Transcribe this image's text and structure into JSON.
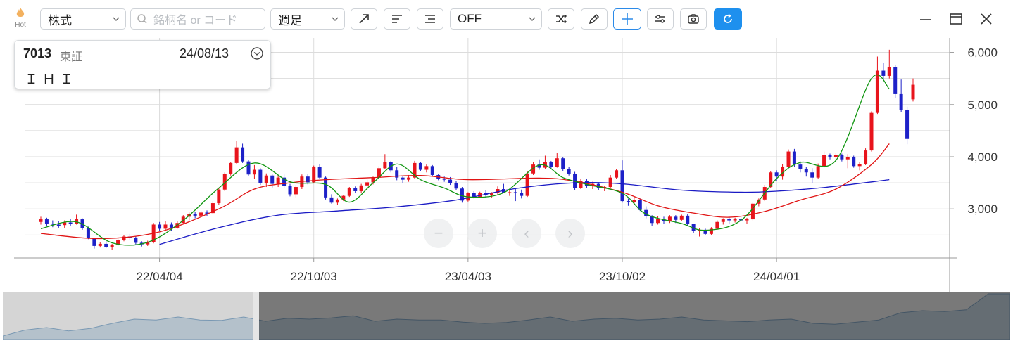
{
  "toolbar": {
    "hot_label": "Hot",
    "market_type": "株式",
    "search_placeholder": "銘柄名 or コード",
    "period": "週足",
    "indicator": "OFF"
  },
  "info": {
    "code": "7013",
    "market": "東証",
    "date": "24/08/13",
    "name": "ＩＨＩ"
  },
  "nav_buttons": {
    "zoom_out": "−",
    "zoom_in": "+",
    "prev": "‹",
    "next": "›"
  },
  "colors": {
    "up": "#e8141c",
    "down": "#1d21c8",
    "ma_short": "#119611",
    "ma_mid": "#e01414",
    "ma_long": "#1a1ac4",
    "accent": "#1e90ee"
  },
  "chart_data": {
    "type": "candlestick",
    "ylim": [
      2100,
      6250
    ],
    "y_ticks": [
      3000,
      4000,
      5000,
      6000
    ],
    "y_tick_labels": [
      "3,000",
      "4,000",
      "5,000",
      "6,000"
    ],
    "x_tick_labels": [
      "22/04/04",
      "22/10/03",
      "23/04/03",
      "23/10/02",
      "24/04/01"
    ],
    "x_tick_index": [
      20,
      46,
      72,
      98,
      124
    ],
    "candles": [
      [
        2750,
        2850,
        2700,
        2800
      ],
      [
        2800,
        2830,
        2680,
        2720
      ],
      [
        2720,
        2780,
        2650,
        2700
      ],
      [
        2700,
        2760,
        2640,
        2690
      ],
      [
        2690,
        2780,
        2640,
        2740
      ],
      [
        2740,
        2800,
        2680,
        2720
      ],
      [
        2720,
        2890,
        2700,
        2800
      ],
      [
        2800,
        2820,
        2600,
        2630
      ],
      [
        2630,
        2660,
        2420,
        2440
      ],
      [
        2440,
        2450,
        2240,
        2290
      ],
      [
        2290,
        2360,
        2260,
        2330
      ],
      [
        2330,
        2380,
        2250,
        2270
      ],
      [
        2270,
        2330,
        2210,
        2310
      ],
      [
        2310,
        2440,
        2290,
        2410
      ],
      [
        2410,
        2500,
        2380,
        2470
      ],
      [
        2470,
        2520,
        2400,
        2440
      ],
      [
        2440,
        2470,
        2320,
        2350
      ],
      [
        2350,
        2380,
        2280,
        2320
      ],
      [
        2320,
        2390,
        2290,
        2360
      ],
      [
        2360,
        2730,
        2340,
        2700
      ],
      [
        2700,
        2750,
        2580,
        2620
      ],
      [
        2620,
        2770,
        2590,
        2700
      ],
      [
        2700,
        2740,
        2580,
        2640
      ],
      [
        2640,
        2760,
        2620,
        2730
      ],
      [
        2730,
        2880,
        2710,
        2850
      ],
      [
        2850,
        2930,
        2780,
        2900
      ],
      [
        2900,
        2940,
        2820,
        2870
      ],
      [
        2870,
        2960,
        2840,
        2930
      ],
      [
        2930,
        2970,
        2860,
        2920
      ],
      [
        2920,
        3150,
        2900,
        3110
      ],
      [
        3110,
        3400,
        3080,
        3370
      ],
      [
        3370,
        3700,
        3340,
        3670
      ],
      [
        3670,
        3900,
        3640,
        3880
      ],
      [
        3880,
        4300,
        3860,
        4180
      ],
      [
        4180,
        4250,
        3880,
        3910
      ],
      [
        3910,
        3930,
        3640,
        3660
      ],
      [
        3660,
        3840,
        3580,
        3750
      ],
      [
        3750,
        3780,
        3460,
        3490
      ],
      [
        3490,
        3680,
        3420,
        3640
      ],
      [
        3640,
        3660,
        3410,
        3480
      ],
      [
        3480,
        3650,
        3420,
        3600
      ],
      [
        3600,
        3660,
        3400,
        3440
      ],
      [
        3440,
        3480,
        3240,
        3280
      ],
      [
        3280,
        3460,
        3220,
        3420
      ],
      [
        3420,
        3660,
        3380,
        3620
      ],
      [
        3620,
        3670,
        3470,
        3510
      ],
      [
        3510,
        3830,
        3490,
        3800
      ],
      [
        3800,
        3860,
        3570,
        3600
      ],
      [
        3600,
        3620,
        3180,
        3220
      ],
      [
        3220,
        3280,
        3100,
        3120
      ],
      [
        3120,
        3200,
        3080,
        3180
      ],
      [
        3180,
        3270,
        3150,
        3250
      ],
      [
        3250,
        3420,
        3230,
        3400
      ],
      [
        3400,
        3430,
        3310,
        3340
      ],
      [
        3340,
        3480,
        3300,
        3450
      ],
      [
        3450,
        3560,
        3370,
        3510
      ],
      [
        3510,
        3620,
        3470,
        3600
      ],
      [
        3600,
        3820,
        3580,
        3780
      ],
      [
        3780,
        4050,
        3760,
        3900
      ],
      [
        3900,
        3920,
        3700,
        3740
      ],
      [
        3740,
        3800,
        3550,
        3600
      ],
      [
        3600,
        3620,
        3500,
        3560
      ],
      [
        3560,
        3650,
        3520,
        3600
      ],
      [
        3600,
        3920,
        3580,
        3880
      ],
      [
        3880,
        3900,
        3720,
        3750
      ],
      [
        3750,
        3850,
        3700,
        3820
      ],
      [
        3820,
        3840,
        3620,
        3650
      ],
      [
        3650,
        3670,
        3550,
        3580
      ],
      [
        3580,
        3620,
        3520,
        3560
      ],
      [
        3560,
        3610,
        3460,
        3490
      ],
      [
        3490,
        3540,
        3360,
        3390
      ],
      [
        3390,
        3420,
        3120,
        3160
      ],
      [
        3160,
        3320,
        3140,
        3300
      ],
      [
        3300,
        3340,
        3200,
        3230
      ],
      [
        3230,
        3330,
        3210,
        3310
      ],
      [
        3310,
        3360,
        3220,
        3260
      ],
      [
        3260,
        3320,
        3220,
        3300
      ],
      [
        3300,
        3430,
        3270,
        3380
      ],
      [
        3380,
        3480,
        3330,
        3300
      ],
      [
        3300,
        3360,
        3250,
        3320
      ],
      [
        3320,
        3400,
        3150,
        3310
      ],
      [
        3310,
        3370,
        3200,
        3250
      ],
      [
        3250,
        3720,
        3230,
        3680
      ],
      [
        3680,
        3900,
        3650,
        3850
      ],
      [
        3850,
        3950,
        3750,
        3790
      ],
      [
        3790,
        4020,
        3760,
        3900
      ],
      [
        3900,
        3920,
        3770,
        3810
      ],
      [
        3810,
        4070,
        3790,
        3970
      ],
      [
        3970,
        3990,
        3720,
        3760
      ],
      [
        3760,
        3800,
        3640,
        3670
      ],
      [
        3670,
        3710,
        3360,
        3400
      ],
      [
        3400,
        3580,
        3380,
        3540
      ],
      [
        3540,
        3570,
        3400,
        3440
      ],
      [
        3440,
        3520,
        3380,
        3480
      ],
      [
        3480,
        3510,
        3360,
        3400
      ],
      [
        3400,
        3440,
        3340,
        3420
      ],
      [
        3420,
        3650,
        3400,
        3600
      ],
      [
        3600,
        3760,
        3580,
        3740
      ],
      [
        3740,
        3930,
        3120,
        3150
      ],
      [
        3150,
        3200,
        3060,
        3130
      ],
      [
        3130,
        3240,
        3100,
        3170
      ],
      [
        3170,
        3200,
        2960,
        2980
      ],
      [
        2980,
        3050,
        2820,
        2860
      ],
      [
        2860,
        2880,
        2680,
        2730
      ],
      [
        2730,
        2860,
        2700,
        2810
      ],
      [
        2810,
        2850,
        2720,
        2760
      ],
      [
        2760,
        2880,
        2730,
        2850
      ],
      [
        2850,
        2880,
        2730,
        2790
      ],
      [
        2790,
        2890,
        2770,
        2870
      ],
      [
        2870,
        2900,
        2680,
        2710
      ],
      [
        2710,
        2720,
        2540,
        2580
      ],
      [
        2580,
        2630,
        2470,
        2600
      ],
      [
        2600,
        2620,
        2500,
        2520
      ],
      [
        2520,
        2650,
        2500,
        2620
      ],
      [
        2620,
        2780,
        2600,
        2750
      ],
      [
        2750,
        2820,
        2700,
        2800
      ],
      [
        2800,
        2840,
        2720,
        2780
      ],
      [
        2780,
        2830,
        2740,
        2800
      ],
      [
        2800,
        2840,
        2760,
        2790
      ],
      [
        2790,
        2830,
        2720,
        2800
      ],
      [
        2800,
        3120,
        2780,
        3100
      ],
      [
        3100,
        3200,
        3050,
        3180
      ],
      [
        3180,
        3460,
        3150,
        3420
      ],
      [
        3420,
        3730,
        3400,
        3700
      ],
      [
        3700,
        3740,
        3540,
        3620
      ],
      [
        3620,
        3860,
        3560,
        3800
      ],
      [
        3800,
        4140,
        3780,
        4100
      ],
      [
        4100,
        4150,
        3800,
        3850
      ],
      [
        3850,
        3910,
        3700,
        3760
      ],
      [
        3760,
        3800,
        3620,
        3700
      ],
      [
        3700,
        3780,
        3500,
        3600
      ],
      [
        3600,
        3870,
        3580,
        3820
      ],
      [
        3820,
        4100,
        3790,
        4030
      ],
      [
        4030,
        4060,
        3950,
        3990
      ],
      [
        3990,
        4080,
        3940,
        4040
      ],
      [
        4040,
        4060,
        3910,
        3950
      ],
      [
        3950,
        4050,
        3780,
        4000
      ],
      [
        4000,
        4020,
        3790,
        3820
      ],
      [
        3820,
        3900,
        3740,
        3860
      ],
      [
        3860,
        4160,
        3840,
        4120
      ],
      [
        4120,
        4870,
        4100,
        4840
      ],
      [
        4840,
        5920,
        4820,
        5650
      ],
      [
        5650,
        5800,
        5450,
        5550
      ],
      [
        5550,
        6050,
        5500,
        5720
      ],
      [
        5720,
        5760,
        5120,
        5200
      ],
      [
        5200,
        5480,
        4860,
        4900
      ],
      [
        4900,
        4960,
        4240,
        4340
      ],
      [
        5100,
        5500,
        5060,
        5380
      ]
    ],
    "ma_short": {
      "name": "MA short",
      "points": [
        [
          0,
          2620
        ],
        [
          6,
          2750
        ],
        [
          12,
          2350
        ],
        [
          18,
          2360
        ],
        [
          24,
          2780
        ],
        [
          30,
          3400
        ],
        [
          36,
          3880
        ],
        [
          42,
          3520
        ],
        [
          48,
          3470
        ],
        [
          52,
          3130
        ],
        [
          56,
          3500
        ],
        [
          60,
          3860
        ],
        [
          64,
          3560
        ],
        [
          68,
          3400
        ],
        [
          72,
          3230
        ],
        [
          78,
          3310
        ],
        [
          84,
          3840
        ],
        [
          88,
          3600
        ],
        [
          92,
          3470
        ],
        [
          98,
          3300
        ],
        [
          102,
          2900
        ],
        [
          108,
          2720
        ],
        [
          112,
          2590
        ],
        [
          118,
          2780
        ],
        [
          124,
          3580
        ],
        [
          128,
          3890
        ],
        [
          134,
          3930
        ],
        [
          140,
          5500
        ],
        [
          143,
          5300
        ]
      ]
    },
    "ma_mid": {
      "name": "MA mid",
      "points": [
        [
          0,
          2530
        ],
        [
          10,
          2430
        ],
        [
          20,
          2560
        ],
        [
          30,
          3000
        ],
        [
          36,
          3380
        ],
        [
          42,
          3500
        ],
        [
          48,
          3560
        ],
        [
          56,
          3600
        ],
        [
          64,
          3640
        ],
        [
          72,
          3560
        ],
        [
          84,
          3590
        ],
        [
          90,
          3530
        ],
        [
          98,
          3320
        ],
        [
          104,
          3060
        ],
        [
          110,
          2920
        ],
        [
          116,
          2840
        ],
        [
          122,
          2950
        ],
        [
          128,
          3170
        ],
        [
          134,
          3380
        ],
        [
          140,
          3850
        ],
        [
          143,
          4250
        ]
      ]
    },
    "ma_long": {
      "name": "MA long",
      "points": [
        [
          20,
          2320
        ],
        [
          30,
          2640
        ],
        [
          40,
          2880
        ],
        [
          50,
          2960
        ],
        [
          60,
          3040
        ],
        [
          70,
          3170
        ],
        [
          80,
          3390
        ],
        [
          90,
          3500
        ],
        [
          98,
          3480
        ],
        [
          108,
          3360
        ],
        [
          118,
          3320
        ],
        [
          124,
          3340
        ],
        [
          132,
          3410
        ],
        [
          143,
          3560
        ]
      ]
    },
    "navigator": [
      0.0,
      0.14,
      0.2,
      0.12,
      0.18,
      0.3,
      0.4,
      0.38,
      0.45,
      0.38,
      0.37,
      0.45,
      0.35,
      0.42,
      0.4,
      0.43,
      0.48,
      0.35,
      0.4,
      0.38,
      0.38,
      0.33,
      0.3,
      0.32,
      0.38,
      0.45,
      0.35,
      0.4,
      0.42,
      0.38,
      0.4,
      0.45,
      0.38,
      0.36,
      0.34,
      0.38,
      0.4,
      0.3,
      0.28,
      0.33,
      0.38,
      0.55,
      0.6,
      0.58,
      0.62,
      1.0,
      1.0
    ]
  }
}
